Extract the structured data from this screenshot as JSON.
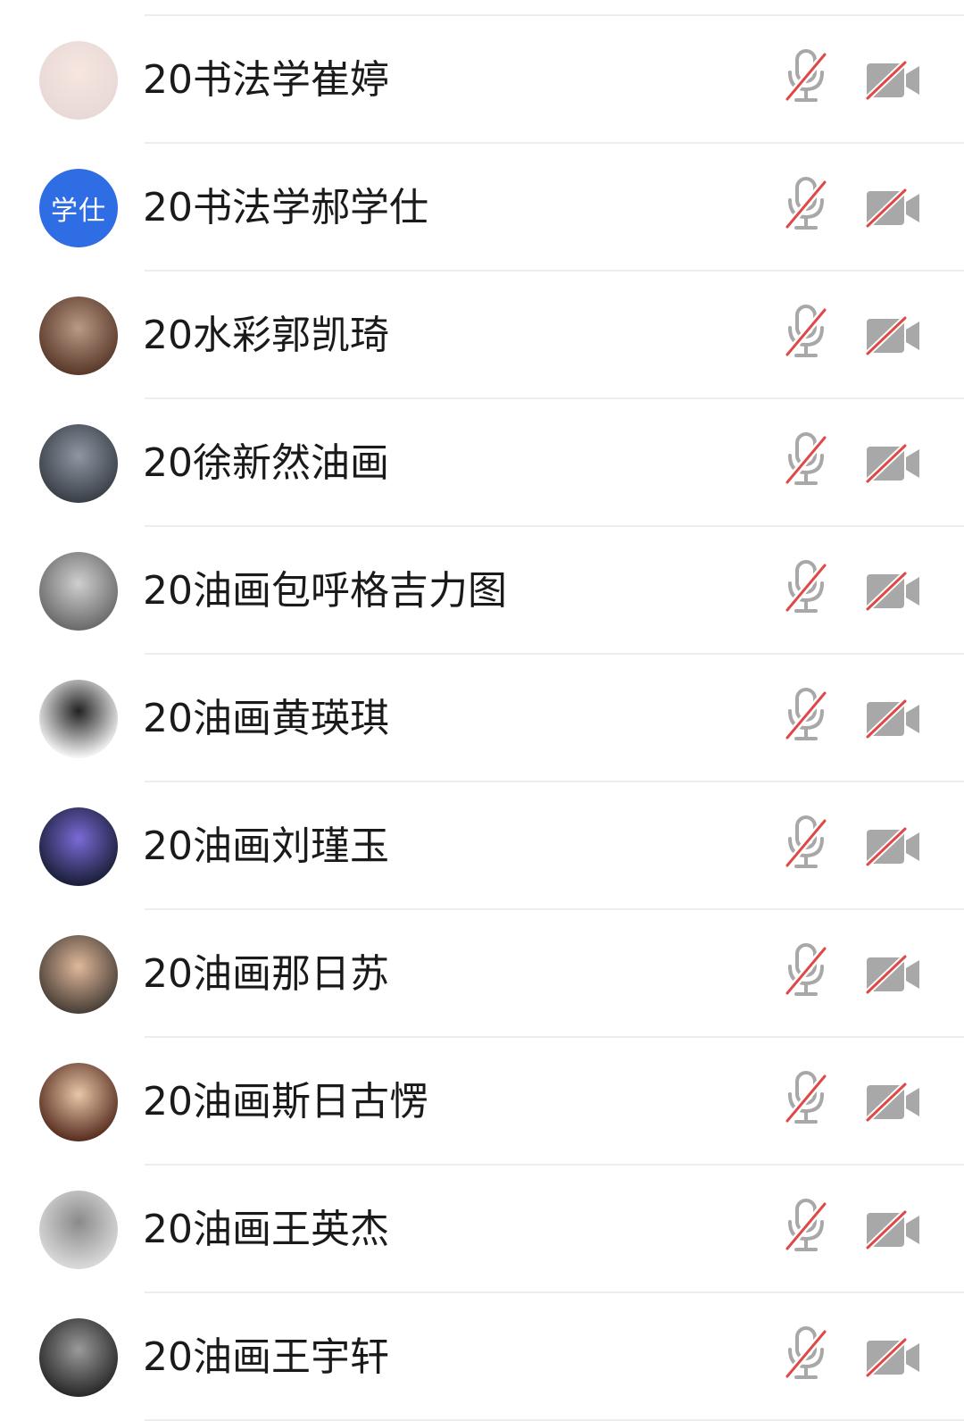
{
  "participants": [
    {
      "name": "20书法学崔婷",
      "avatar_text": "",
      "avatar_bg": "#e8d9d6",
      "avatar_fg": "#f7e6e0",
      "mic": "muted",
      "camera": "off"
    },
    {
      "name": "20书法学郝学仕",
      "avatar_text": "学仕",
      "avatar_bg": "#2f6de5",
      "avatar_fg": "#2f6de5",
      "mic": "muted",
      "camera": "off"
    },
    {
      "name": "20水彩郭凯琦",
      "avatar_text": "",
      "avatar_bg": "#5a3a2a",
      "avatar_fg": "#b89a86",
      "mic": "muted",
      "camera": "off"
    },
    {
      "name": "20徐新然油画",
      "avatar_text": "",
      "avatar_bg": "#3a4048",
      "avatar_fg": "#8e97a3",
      "mic": "muted",
      "camera": "off"
    },
    {
      "name": "20油画包呼格吉力图",
      "avatar_text": "",
      "avatar_bg": "#6b6b6b",
      "avatar_fg": "#cfcfcf",
      "mic": "muted",
      "camera": "off"
    },
    {
      "name": "20油画黄瑛琪",
      "avatar_text": "",
      "avatar_bg": "#f4f4f4",
      "avatar_fg": "#222222",
      "mic": "muted",
      "camera": "off"
    },
    {
      "name": "20油画刘瑾玉",
      "avatar_text": "",
      "avatar_bg": "#1b1f3a",
      "avatar_fg": "#7a6bd6",
      "mic": "muted",
      "camera": "off"
    },
    {
      "name": "20油画那日苏",
      "avatar_text": "",
      "avatar_bg": "#4a4038",
      "avatar_fg": "#e0b89a",
      "mic": "muted",
      "camera": "off"
    },
    {
      "name": "20油画斯日古愣",
      "avatar_text": "",
      "avatar_bg": "#5a2f22",
      "avatar_fg": "#e8c7a8",
      "mic": "muted",
      "camera": "off"
    },
    {
      "name": "20油画王英杰",
      "avatar_text": "",
      "avatar_bg": "#d9d9d9",
      "avatar_fg": "#8a8a8a",
      "mic": "muted",
      "camera": "off"
    },
    {
      "name": "20油画王宇轩",
      "avatar_text": "",
      "avatar_bg": "#2a2a2a",
      "avatar_fg": "#9a9a9a",
      "mic": "muted",
      "camera": "off"
    }
  ],
  "icons": {
    "mic": "mic-muted-icon",
    "camera": "camera-off-icon"
  },
  "colors": {
    "icon_gray": "#a8a8a8",
    "slash_red": "#e04848",
    "divider": "#ededed",
    "text": "#1a1a1a"
  }
}
